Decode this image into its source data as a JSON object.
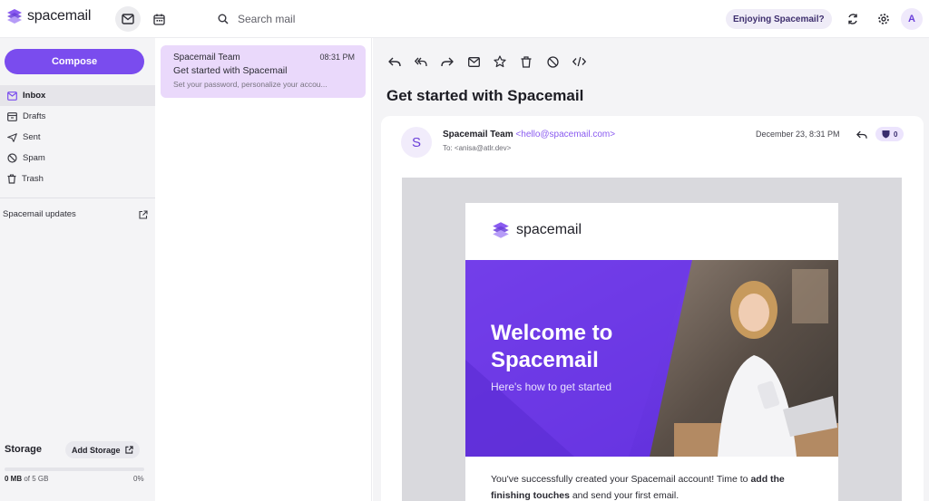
{
  "app": {
    "logo_text": "spacemail",
    "brand_color": "#7a4cee"
  },
  "topbar": {
    "search_placeholder": "Search mail",
    "enjoy_label": "Enjoying Spacemail?",
    "avatar_letter": "A",
    "icons": [
      "mail-icon",
      "calendar-icon",
      "search-icon",
      "refresh-icon",
      "gear-icon"
    ]
  },
  "sidebar": {
    "compose_label": "Compose",
    "items": [
      {
        "label": "Inbox",
        "icon": "inbox-icon",
        "active": true
      },
      {
        "label": "Drafts",
        "icon": "drafts-icon",
        "active": false
      },
      {
        "label": "Sent",
        "icon": "send-icon",
        "active": false
      },
      {
        "label": "Spam",
        "icon": "spam-icon",
        "active": false
      },
      {
        "label": "Trash",
        "icon": "trash-icon",
        "active": false
      }
    ],
    "updates_label": "Spacemail updates",
    "storage": {
      "title": "Storage",
      "add_label": "Add Storage",
      "used": "0 MB",
      "total_text": "of 5 GB",
      "percent_text": "0%",
      "percent_value": 0
    }
  },
  "message_list": {
    "items": [
      {
        "sender": "Spacemail Team",
        "time": "08:31 PM",
        "subject": "Get started with Spacemail",
        "snippet": "Set your password, personalize your accou..."
      }
    ]
  },
  "reader": {
    "toolbar": [
      "reply-icon",
      "reply-all-icon",
      "forward-icon",
      "mark-unread-icon",
      "star-icon",
      "trash-icon",
      "block-icon",
      "code-icon"
    ],
    "subject": "Get started with Spacemail",
    "sender_initial": "S",
    "sender_name": "Spacemail Team",
    "sender_email": "<hello@spacemail.com>",
    "to_line": "To: <anisa@atlr.dev>",
    "date": "December 23, 8:31 PM",
    "shield_count": "0",
    "email": {
      "logo_text": "spacemail",
      "hero_title_line1": "Welcome to",
      "hero_title_line2": "Spacemail",
      "hero_subtitle": "Here's how to get started",
      "body_intro": "You've successfully created your Spacemail account! Time to ",
      "body_bold1": "add the finishing touches",
      "body_rest": " and send your first email."
    }
  }
}
